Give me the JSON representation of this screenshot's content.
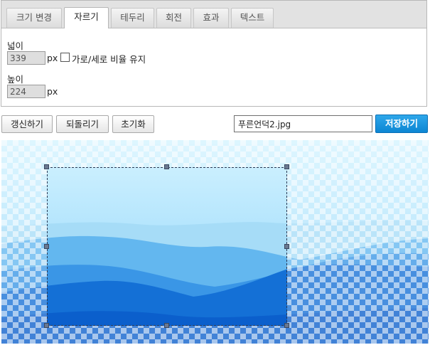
{
  "tabs": [
    {
      "label": "크기 변경",
      "active": false
    },
    {
      "label": "자르기",
      "active": true
    },
    {
      "label": "테두리",
      "active": false
    },
    {
      "label": "회전",
      "active": false
    },
    {
      "label": "효과",
      "active": false
    },
    {
      "label": "텍스트",
      "active": false
    }
  ],
  "crop": {
    "width_label": "넓이",
    "width_value": "339",
    "height_label": "높이",
    "height_value": "224",
    "unit": "px",
    "keep_ratio_label": "가로/세로 비율 유지",
    "keep_ratio_checked": false
  },
  "toolbar": {
    "refresh_label": "갱신하기",
    "undo_label": "되돌리기",
    "reset_label": "초기화",
    "filename": "푸른언덕2.jpg",
    "save_label": "저장하기"
  },
  "colors": {
    "accent": "#1a93dd",
    "sky_light": "#c9efff",
    "sky_mid": "#8fd6fb",
    "hill_far": "#5fb8f0",
    "hill_mid": "#2f92e6",
    "hill_near": "#0a5ecf"
  },
  "icons": {
    "checkbox": "checkbox-empty"
  }
}
